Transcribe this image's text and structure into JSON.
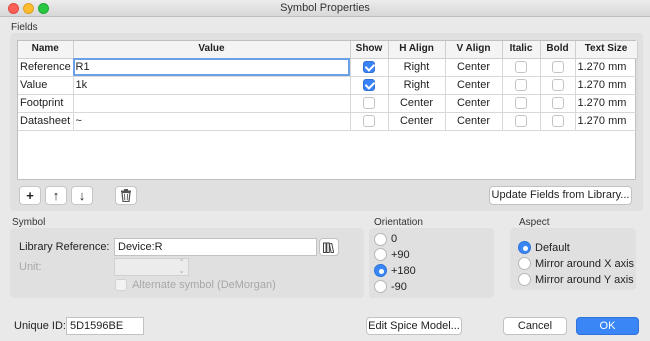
{
  "window": {
    "title": "Symbol Properties"
  },
  "fields": {
    "section_label": "Fields",
    "columns": [
      "Name",
      "Value",
      "Show",
      "H Align",
      "V Align",
      "Italic",
      "Bold",
      "Text Size"
    ],
    "rows": [
      {
        "name": "Reference",
        "value": "R1",
        "show": true,
        "h_align": "Right",
        "v_align": "Center",
        "italic": false,
        "bold": false,
        "text_size": "1.270 mm"
      },
      {
        "name": "Value",
        "value": "1k",
        "show": true,
        "h_align": "Right",
        "v_align": "Center",
        "italic": false,
        "bold": false,
        "text_size": "1.270 mm"
      },
      {
        "name": "Footprint",
        "value": "",
        "show": false,
        "h_align": "Center",
        "v_align": "Center",
        "italic": false,
        "bold": false,
        "text_size": "1.270 mm"
      },
      {
        "name": "Datasheet",
        "value": "~",
        "show": false,
        "h_align": "Center",
        "v_align": "Center",
        "italic": false,
        "bold": false,
        "text_size": "1.270 mm"
      }
    ],
    "toolbar": {
      "add": "+",
      "up": "↑",
      "down": "↓",
      "delete_icon": "trash-icon"
    },
    "update_button": "Update Fields from Library..."
  },
  "symbol": {
    "section_label": "Symbol",
    "library_reference_label": "Library Reference:",
    "library_reference_value": "Device:R",
    "browse_icon": "library-browse-icon",
    "unit_label": "Unit:",
    "unit_value": "",
    "alternate_label": "Alternate symbol (DeMorgan)",
    "alternate_checked": false
  },
  "orientation": {
    "section_label": "Orientation",
    "options": [
      "0",
      "+90",
      "+180",
      "-90"
    ],
    "selected": "+180"
  },
  "aspect": {
    "section_label": "Aspect",
    "options": [
      "Default",
      "Mirror around X axis",
      "Mirror around Y axis"
    ],
    "selected": "Default"
  },
  "footer": {
    "unique_id_label": "Unique ID:",
    "unique_id_value": "5D1596BE",
    "edit_spice_button": "Edit Spice Model...",
    "cancel_button": "Cancel",
    "ok_button": "OK"
  },
  "colors": {
    "accent": "#3b86f7",
    "traffic_red": "#fc5f57",
    "traffic_yellow": "#fdbc2e",
    "traffic_green": "#28c840"
  }
}
